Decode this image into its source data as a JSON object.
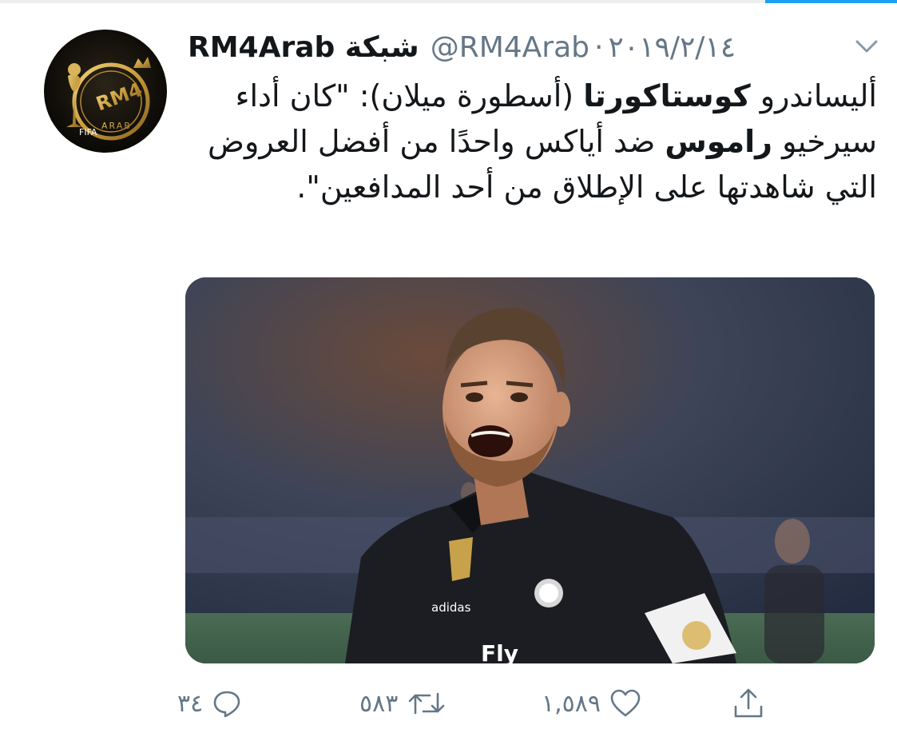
{
  "author": {
    "name": "شبكة RM4Arab",
    "handle": "@RM4Arab",
    "separator": "·",
    "date": "٢٠١٩/٢/١٤",
    "avatar_text": "RM4 ARAB",
    "avatar_badge": "FIFA"
  },
  "tweet": {
    "part1": "أليساندرو ",
    "bold1": "كوستاكورتا",
    "part2": " (أسطورة ميلان): \"كان أداء سيرخيو ",
    "bold2": "راموس",
    "part3": " ضد أياكس واحدًا من أفضل العروض التي شاهدتها على الإطلاق من أحد المدافعين\"."
  },
  "media": {
    "jersey_text": "Fly",
    "brand_text": "adidas"
  },
  "actions": {
    "replies": "٣٤",
    "retweets": "٥٨٣",
    "likes": "١,٥٨٩"
  },
  "icons": {
    "reply": "reply-icon",
    "retweet": "retweet-icon",
    "like": "heart-icon",
    "share": "share-icon",
    "menu": "chevron-down-icon"
  },
  "colors": {
    "text": "#14171a",
    "secondary": "#657786",
    "accent": "#1da1f2"
  }
}
